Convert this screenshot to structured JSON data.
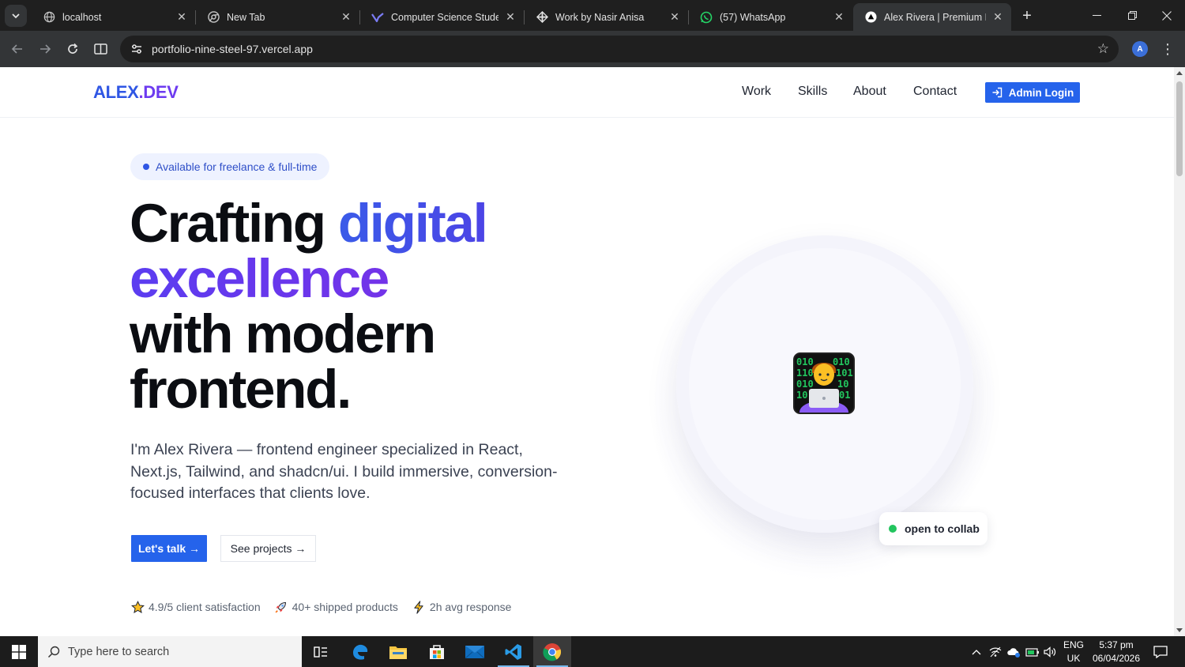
{
  "browser": {
    "tabs": [
      {
        "title": "localhost",
        "icon": "globe-icon"
      },
      {
        "title": "New Tab",
        "icon": "chrome-icon"
      },
      {
        "title": "Computer Science Student",
        "icon": "figma-like-icon"
      },
      {
        "title": "Work by Nasir Anisa",
        "icon": "framer-icon"
      },
      {
        "title": "(57) WhatsApp",
        "icon": "whatsapp-icon"
      },
      {
        "title": "Alex Rivera | Premium Fron",
        "icon": "vercel-icon"
      }
    ],
    "url": "portfolio-nine-steel-97.vercel.app",
    "profile_initial": "A"
  },
  "site": {
    "logo": {
      "part1": "ALEX",
      "part2": ".",
      "part3": "DEV"
    },
    "nav": [
      "Work",
      "Skills",
      "About",
      "Contact"
    ],
    "admin_button": "Admin Login"
  },
  "hero": {
    "availability": "Available for freelance & full-time",
    "title": {
      "line1_plain": "Crafting ",
      "line1_accent": "digital",
      "line2_accent": "excellence",
      "line3": "with modern",
      "line4": "frontend."
    },
    "description": "I'm Alex Rivera — frontend engineer specialized in React, Next.js, Tailwind, and shadcn/ui. I build immersive, conversion-focused interfaces that clients love.",
    "cta_primary": "Let's talk →",
    "cta_secondary": "See projects →",
    "stats": [
      {
        "icon": "star-icon",
        "text": "4.9/5 client satisfaction"
      },
      {
        "icon": "rocket-icon",
        "text": "40+ shipped products"
      },
      {
        "icon": "lightning-icon",
        "text": "2h avg response"
      }
    ],
    "badge": "open to collab",
    "avatar_emoji": "technologist-emoji"
  },
  "taskbar": {
    "search_placeholder": "Type here to search",
    "language": {
      "line1": "ENG",
      "line2": "UK"
    },
    "time": "5:37 pm",
    "date": "06/04/2026"
  },
  "colors": {
    "accent_blue": "#2563eb",
    "accent_purple": "#7c3aed",
    "status_green": "#22c55e"
  }
}
